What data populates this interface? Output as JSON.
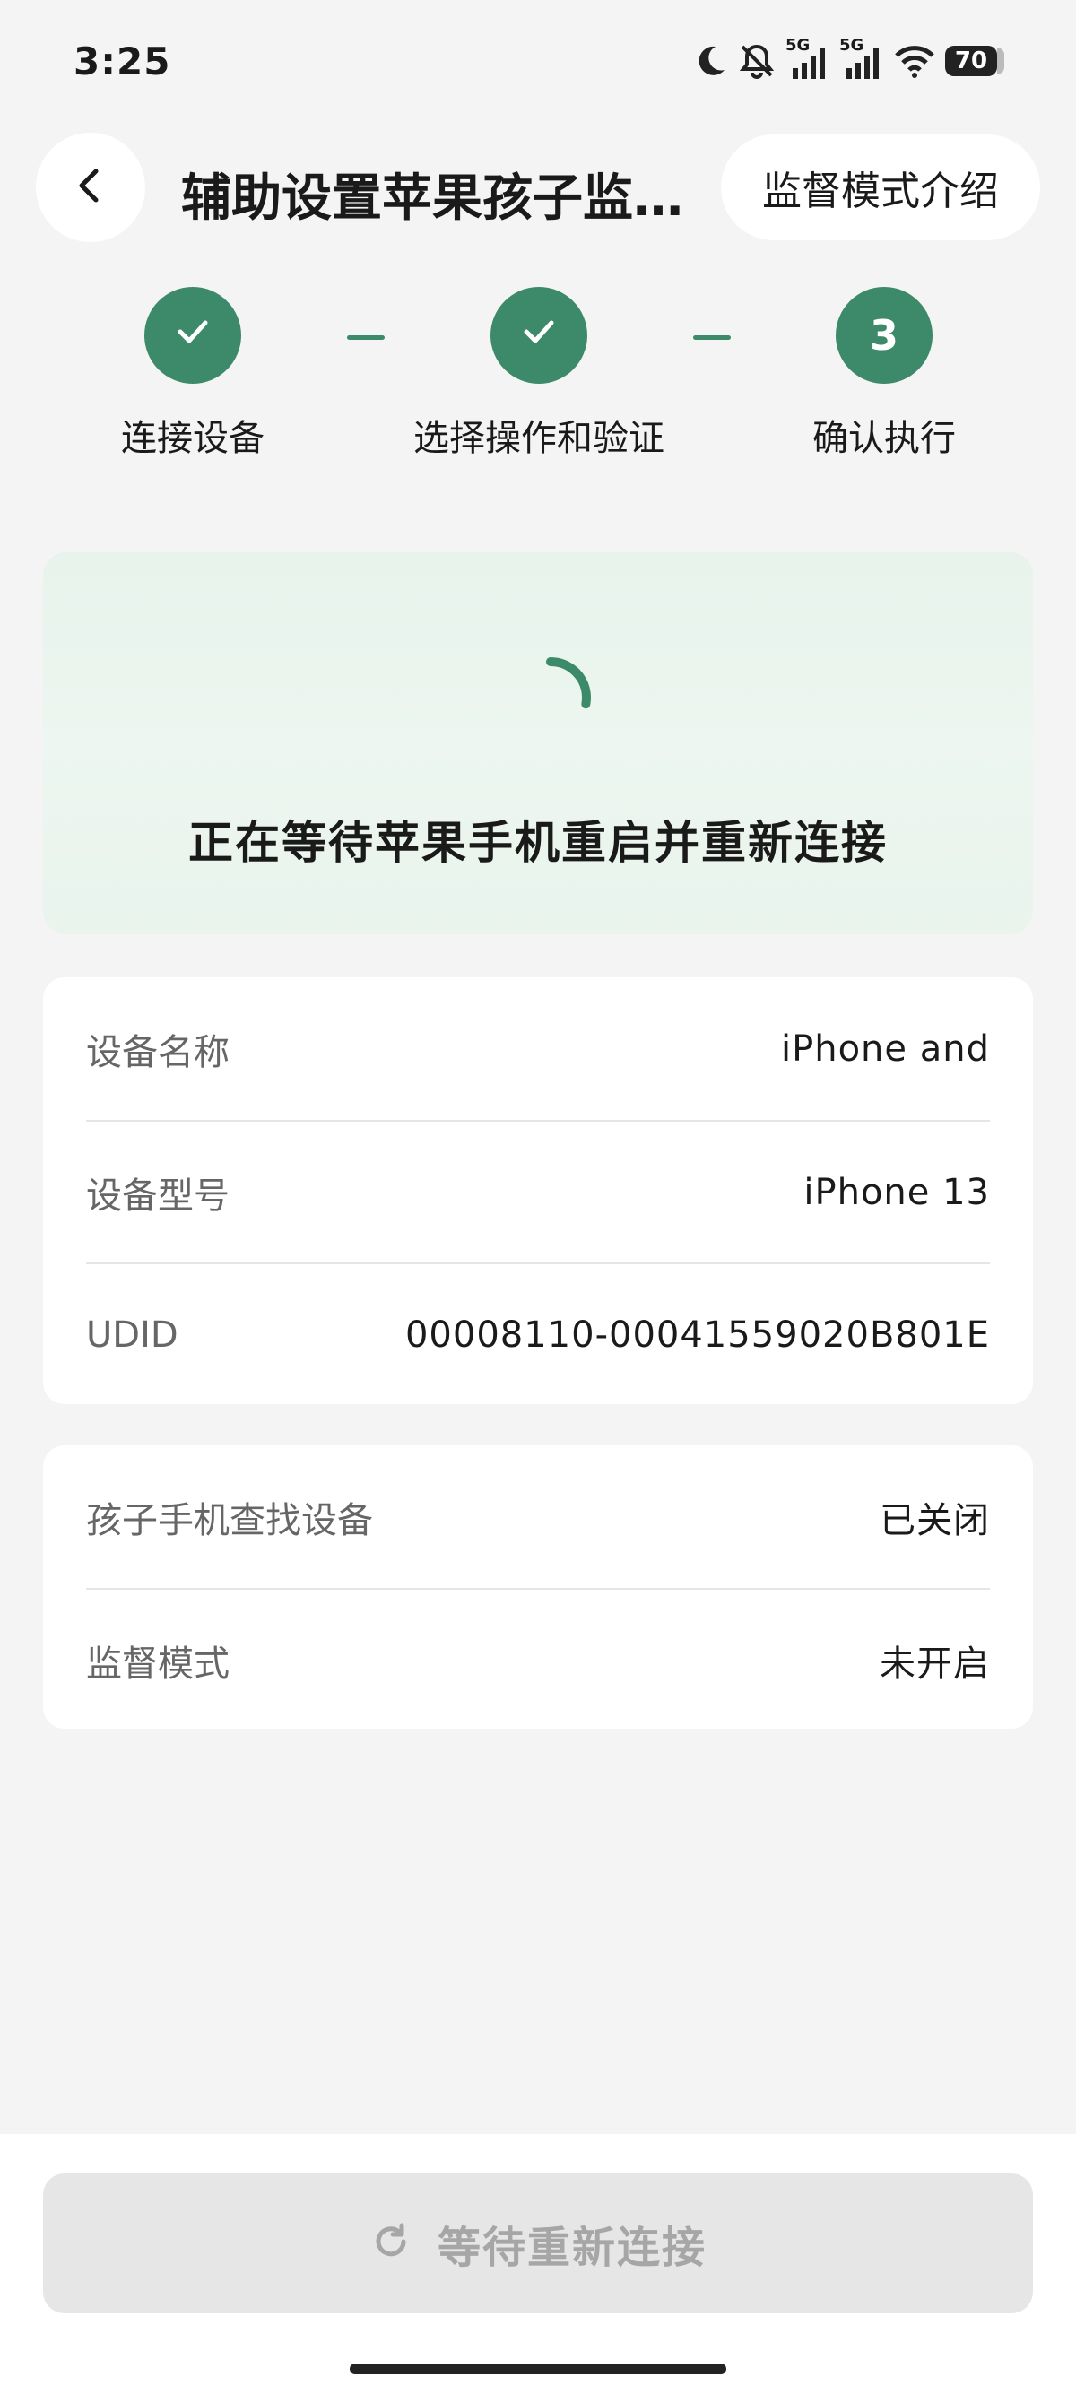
{
  "status_bar": {
    "time": "3:25",
    "network_1": "5G",
    "network_2": "5G",
    "battery": "70",
    "icons": [
      "moon-icon",
      "bell-muted-icon",
      "signal-icon",
      "signal-icon",
      "wifi-icon",
      "battery-icon"
    ]
  },
  "header": {
    "title": "辅助设置苹果孩子监...",
    "intro_label": "监督模式介绍",
    "back_icon": "chevron-left-icon"
  },
  "steps": [
    {
      "label": "连接设备",
      "state": "done",
      "marker": ""
    },
    {
      "label": "选择操作和验证",
      "state": "done",
      "marker": ""
    },
    {
      "label": "确认执行",
      "state": "current",
      "marker": "3"
    }
  ],
  "waiting": {
    "message": "正在等待苹果手机重启并重新连接",
    "icon": "loading-spinner-icon"
  },
  "device_info": [
    {
      "label": "设备名称",
      "value": "iPhone and"
    },
    {
      "label": "设备型号",
      "value": "iPhone 13"
    },
    {
      "label": "UDID",
      "value": "00008110-00041559020B801E"
    }
  ],
  "status_info": [
    {
      "label": "孩子手机查找设备",
      "value": "已关闭"
    },
    {
      "label": "监督模式",
      "value": "未开启"
    }
  ],
  "footer": {
    "button_label": "等待重新连接",
    "button_icon": "refresh-icon"
  },
  "colors": {
    "accent": "#3c8a6a",
    "background": "#f4f4f4",
    "card": "#ffffff",
    "waiting_card": "#e9f4ed",
    "disabled_button": "#e6e6e6",
    "disabled_text": "#a6a6a6"
  }
}
